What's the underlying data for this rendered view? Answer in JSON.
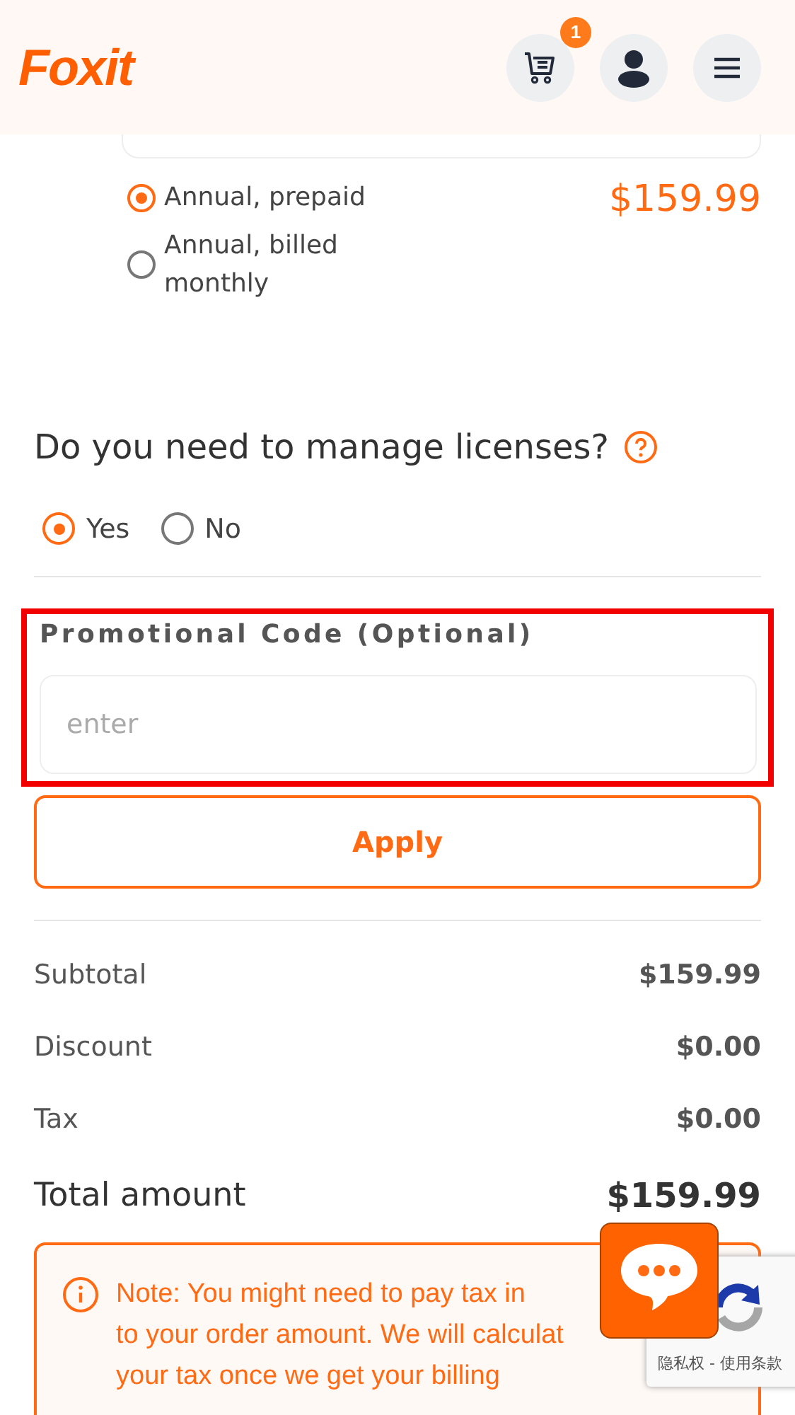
{
  "header": {
    "logo": "Foxit",
    "cart_count": "1"
  },
  "billing_options": [
    {
      "label": "Annual, prepaid",
      "selected": true,
      "price": "$159.99"
    },
    {
      "label": "Annual, billed monthly",
      "selected": false
    }
  ],
  "licenses": {
    "question": "Do you need to manage licenses?",
    "options": [
      {
        "label": "Yes",
        "selected": true
      },
      {
        "label": "No",
        "selected": false
      }
    ]
  },
  "promo": {
    "label": "Promotional Code (Optional)",
    "placeholder": "enter",
    "highlighted": true,
    "button": "Apply"
  },
  "summary": [
    {
      "label": "Subtotal",
      "value": "$159.99"
    },
    {
      "label": "Discount",
      "value": "$0.00"
    },
    {
      "label": "Tax",
      "value": "$0.00"
    }
  ],
  "total": {
    "label": "Total amount",
    "value": "$159.99"
  },
  "note_lines": [
    "Note: You might need to pay tax in",
    "to your order amount. We will calculat",
    "your tax once we get your billing"
  ],
  "recaptcha": {
    "links": "隐私权 - 使用条款"
  }
}
